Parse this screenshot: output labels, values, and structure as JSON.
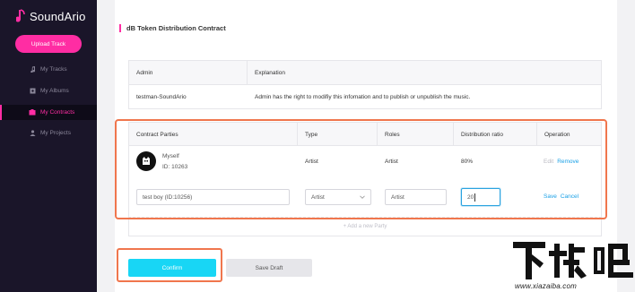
{
  "app": {
    "name": "SoundArio",
    "brand_color": "#ff2da3"
  },
  "sidebar": {
    "upload_label": "Upload Track",
    "items": [
      {
        "label": "My Tracks",
        "icon": "music-note-icon",
        "active": false
      },
      {
        "label": "My Albums",
        "icon": "album-icon",
        "active": false
      },
      {
        "label": "My Contracts",
        "icon": "contract-icon",
        "active": true
      },
      {
        "label": "My Projects",
        "icon": "user-icon",
        "active": false
      }
    ]
  },
  "page": {
    "title": "dB Token Distribution Contract"
  },
  "admin_table": {
    "headers": [
      "Admin",
      "Explanation"
    ],
    "row": [
      "testman-SoundArio",
      "Admin has the right to modifiy this infomation and to publish or unpublish the music."
    ]
  },
  "parties_table": {
    "headers": [
      "Contract Parties",
      "Type",
      "Roles",
      "Distribution ratio",
      "Operation"
    ],
    "row1": {
      "name": "Myself",
      "id": "ID: 10263",
      "type": "Artist",
      "role": "Artist",
      "ratio": "80%",
      "edit": "Edit",
      "remove": "Remove"
    },
    "row2": {
      "party_value": "test boy (ID:10256)",
      "type_value": "Artist",
      "role_value": "Artist",
      "ratio_value": "20",
      "save": "Save",
      "cancel": "Cancel"
    },
    "add_label": "+ Add a new Party"
  },
  "actions": {
    "confirm": "Confirm",
    "draft": "Save Draft"
  },
  "watermark": {
    "text": "下载吧",
    "url": "www.xiazaiba.com"
  }
}
